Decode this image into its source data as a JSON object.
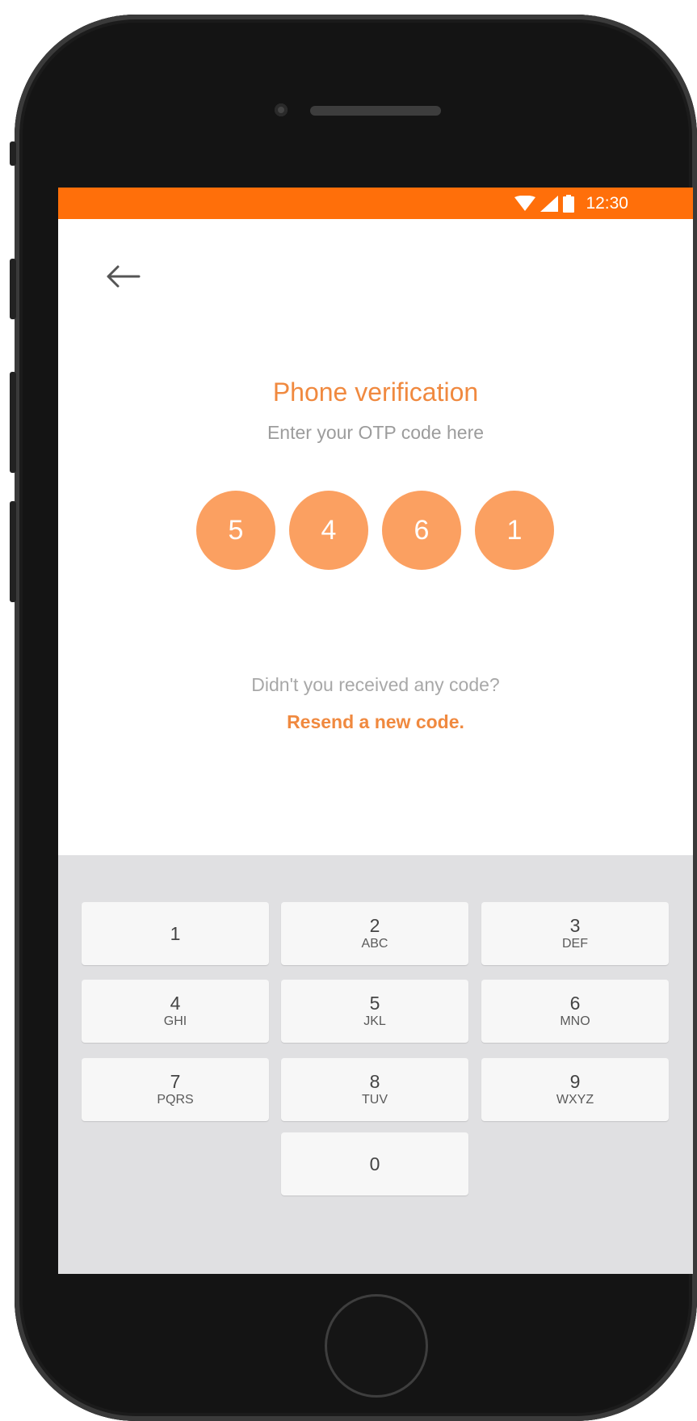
{
  "status_bar": {
    "time": "12:30",
    "icons": [
      "wifi-icon",
      "signal-icon",
      "battery-icon"
    ],
    "color": "#ff6f0a"
  },
  "header": {
    "back_icon": "arrow-left-icon"
  },
  "verification": {
    "title": "Phone verification",
    "subtitle": "Enter your OTP code here",
    "digits": [
      "5",
      "4",
      "6",
      "1"
    ],
    "no_code_text": "Didn't you received any code?",
    "resend_label": "Resend a new code."
  },
  "keypad": {
    "keys": [
      {
        "num": "1",
        "letters": ""
      },
      {
        "num": "2",
        "letters": "ABC"
      },
      {
        "num": "3",
        "letters": "DEF"
      },
      {
        "num": "4",
        "letters": "GHI"
      },
      {
        "num": "5",
        "letters": "JKL"
      },
      {
        "num": "6",
        "letters": "MNO"
      },
      {
        "num": "7",
        "letters": "PQRS"
      },
      {
        "num": "8",
        "letters": "TUV"
      },
      {
        "num": "9",
        "letters": "WXYZ"
      },
      {
        "num": "0",
        "letters": ""
      }
    ]
  },
  "colors": {
    "accent": "#f0893f",
    "digit_bg": "#fba061",
    "keypad_bg": "#e0e0e2"
  }
}
